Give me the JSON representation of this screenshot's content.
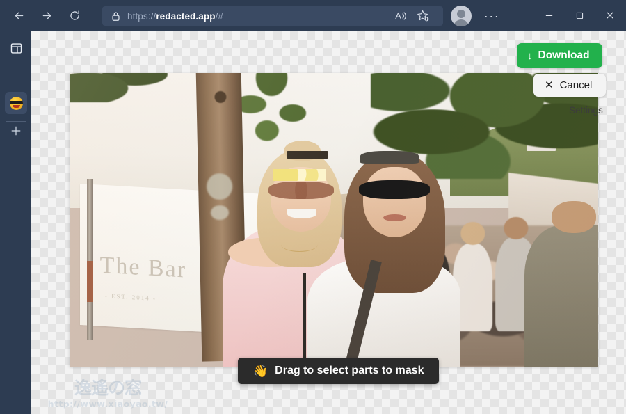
{
  "browser": {
    "nav": {
      "back_label": "Back",
      "forward_label": "Forward",
      "refresh_label": "Refresh"
    },
    "address_bar": {
      "lock_icon": "lock-icon",
      "url_prefix": "https://",
      "url_domain": "redacted.app",
      "url_suffix": "/#",
      "full_url": "https://redacted.app/#"
    },
    "address_actions": {
      "read_aloud_label": "Read aloud",
      "favorites_label": "Add this page to favorites"
    },
    "profile_label": "Profile",
    "more_label": "···",
    "window": {
      "minimize_label": "Minimize",
      "maximize_label": "Maximize",
      "close_label": "Close"
    }
  },
  "tabstrip": {
    "tab_list_label": "Tab actions menu",
    "active_tab_label": "redacted.app",
    "new_tab_label": "New tab"
  },
  "page": {
    "download_button": {
      "icon": "download-arrow-icon",
      "arrow": "↓",
      "label": "Download"
    },
    "cancel_button": {
      "icon": "close-x-icon",
      "x": "✕",
      "label": "Cancel"
    },
    "settings_link": "Settings",
    "drag_hint": {
      "emoji": "👋",
      "label": "Drag to select parts to mask"
    },
    "photo": {
      "alt": "Two women at an outdoor festival with a crowd, tree trunk and white banner",
      "banner_text": "The        Bar",
      "banner_est": "- EST. 2014 -"
    }
  },
  "watermark": {
    "mark": "逸遙の窓",
    "url": "http://www.xiaoyao.tw/"
  },
  "colors": {
    "chrome": "#2d3c52",
    "urlbar": "#3a4a63",
    "accent_green": "#22b14c",
    "hint_dark": "#2b2b2b"
  }
}
